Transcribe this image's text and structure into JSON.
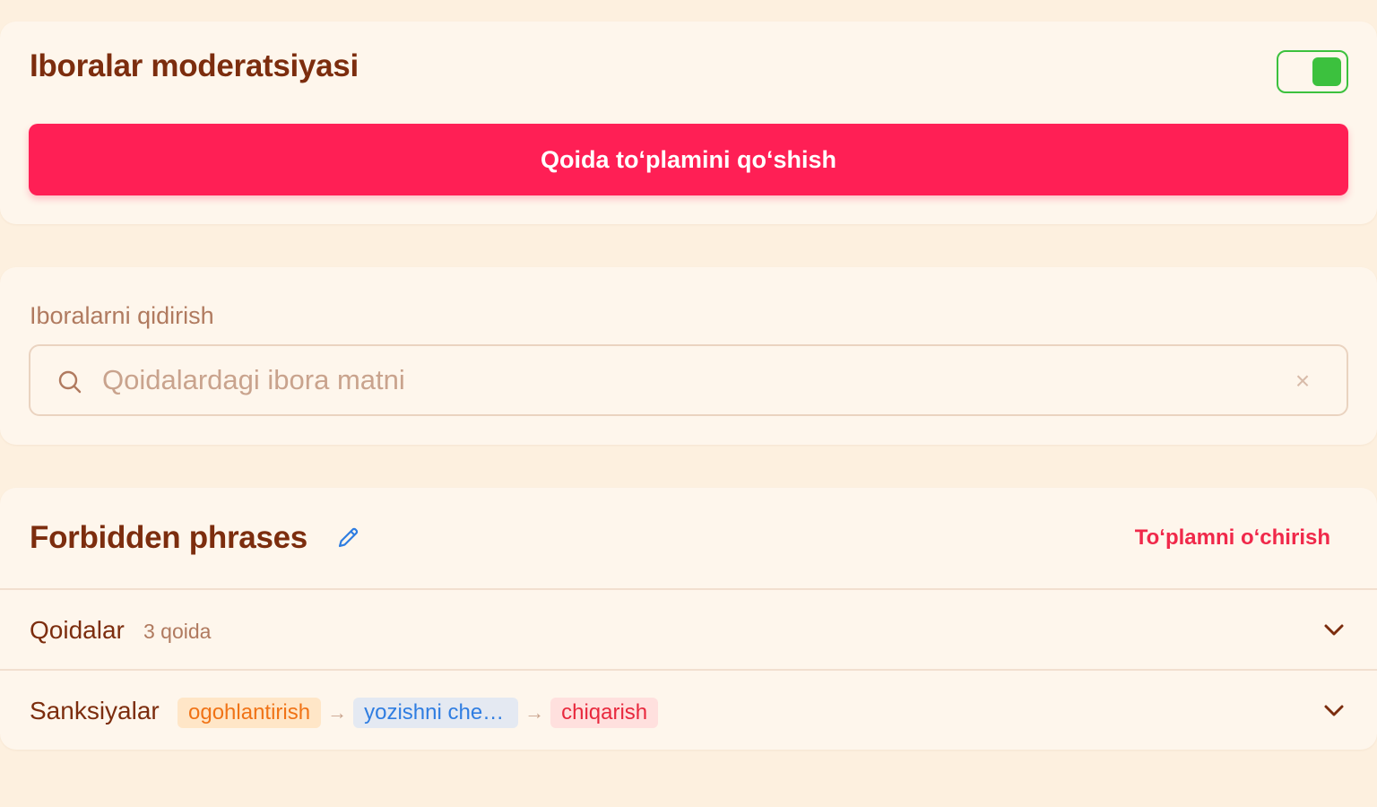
{
  "moderation": {
    "title": "Iboralar moderatsiyasi",
    "enabled": true,
    "add_button_label": "Qoida toʻplamini qoʻshish"
  },
  "search": {
    "label": "Iboralarni qidirish",
    "placeholder": "Qoidalardagi ibora matni",
    "value": "",
    "icon": "search-icon",
    "clear_icon": "×"
  },
  "ruleset": {
    "title": "Forbidden phrases",
    "edit_icon": "pencil-icon",
    "delete_label": "Toʻplamni oʻchirish",
    "rules": {
      "label": "Qoidalar",
      "count": "3 qoida"
    },
    "sanctions": {
      "label": "Sanksiyalar",
      "chips": [
        "ogohlantirish",
        "yozishni cheklash",
        "chiqarish"
      ],
      "arrow": "→"
    }
  },
  "colors": {
    "background": "#fdf0df",
    "card": "#fef6ec",
    "title": "#7c2d0e",
    "primary": "#ff1f55",
    "toggle_on": "#3cc13e",
    "danger": "#f0294a",
    "edit_icon": "#2f7de1"
  }
}
